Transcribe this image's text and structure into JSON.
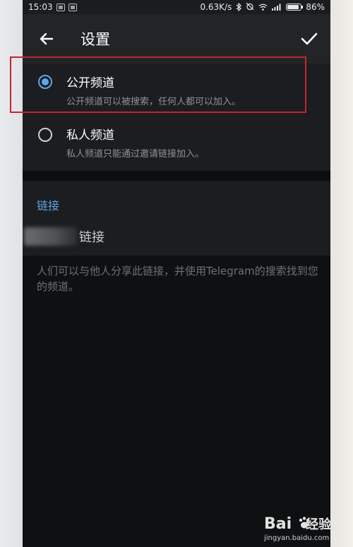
{
  "status_bar": {
    "time": "15:03",
    "network_speed": "0.63K/s",
    "battery": "86%",
    "battery_level": 0.86
  },
  "app_bar": {
    "title": "设置",
    "back_icon": "arrow-left-icon",
    "confirm_icon": "checkmark-icon"
  },
  "channel_type": {
    "options": [
      {
        "title": "公开频道",
        "description": "公开频道可以被搜索，任何人都可以加入。",
        "selected": true
      },
      {
        "title": "私人频道",
        "description": "私人频道只能通过邀请链接加入。",
        "selected": false
      }
    ]
  },
  "link": {
    "header": "链接",
    "suffix": "链接",
    "hint": "人们可以与他人分享此链接，并使用Telegram的搜索找到您的频道。"
  },
  "watermark": {
    "logo": "Bai",
    "logo_suffix": "经验",
    "url": "jingyan.baidu.com"
  },
  "colors": {
    "accent": "#5fa6e6",
    "highlight": "#c8232c",
    "background": "#0f1011"
  }
}
